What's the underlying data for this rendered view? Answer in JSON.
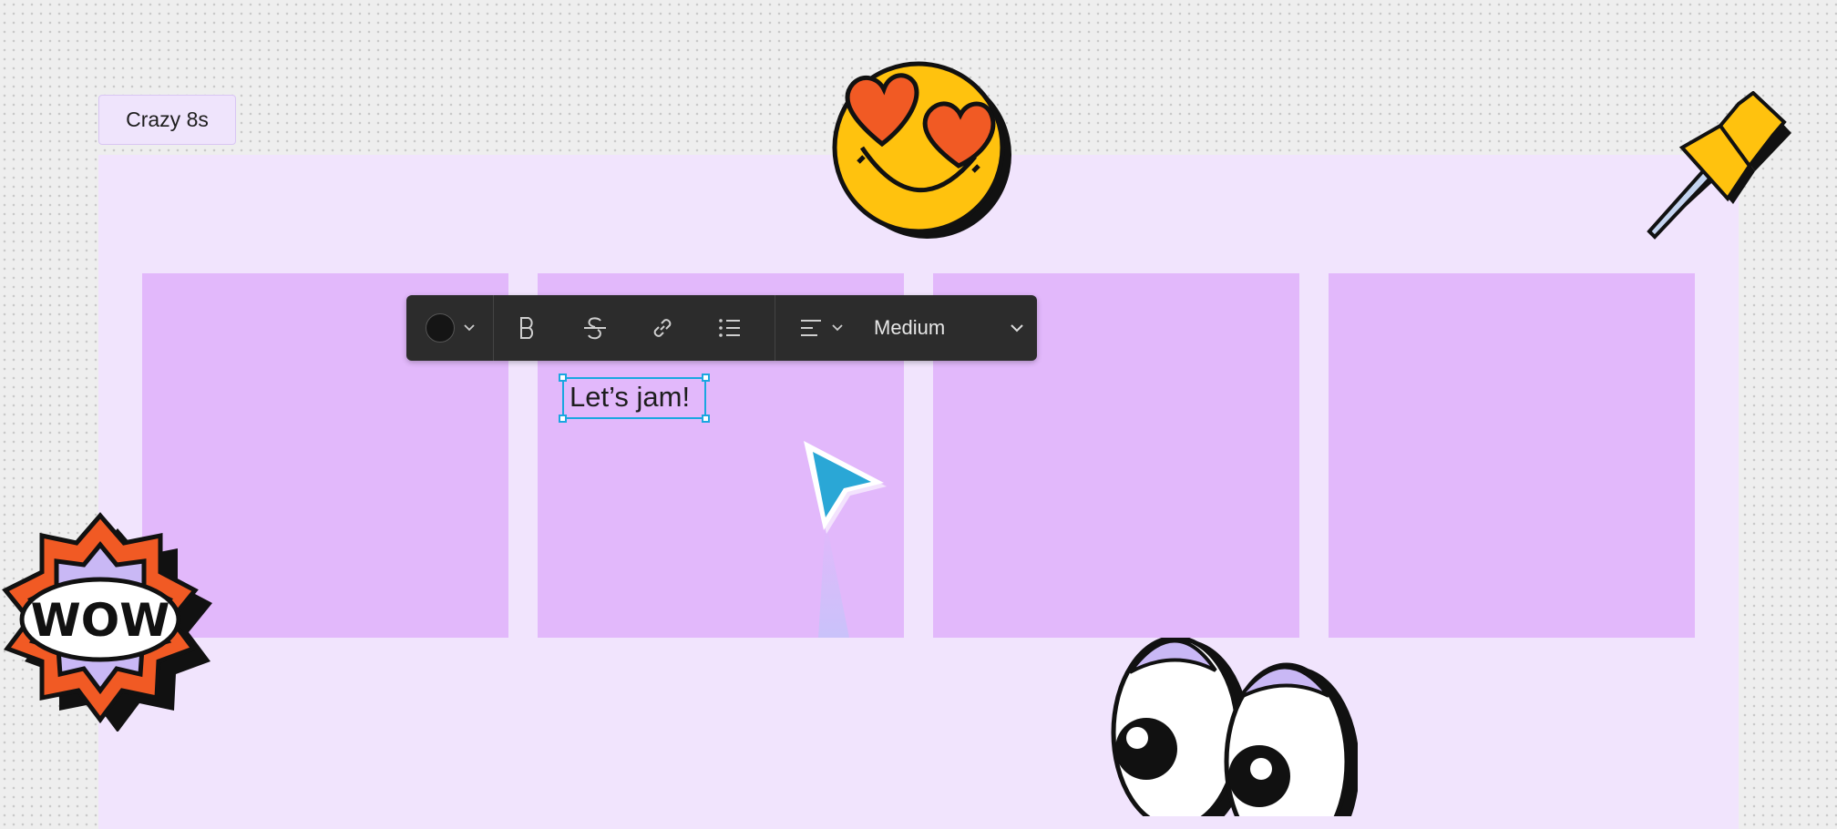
{
  "section": {
    "title": "Crazy 8s"
  },
  "toolbar": {
    "text_color_icon": "text-color-swatch",
    "bold_icon": "bold-icon",
    "strikethrough_icon": "strikethrough-icon",
    "link_icon": "link-icon",
    "list_icon": "bulleted-list-icon",
    "align_icon": "align-left-icon",
    "font_size": "Medium"
  },
  "text_box": {
    "value": "Let’s jam!"
  },
  "stickers": {
    "wow": "WOW",
    "heart_eyes": "heart-eyes-emoji",
    "pushpin": "pushpin",
    "eyes": "googly-eyes"
  },
  "colors": {
    "canvas_bg": "#eeeeee",
    "section_bg": "#f1e4fd",
    "sticky_bg": "#e2b8fb",
    "toolbar_bg": "#2c2c2c",
    "selection": "#1aa7e0",
    "cursor": "#2aa7d6"
  }
}
